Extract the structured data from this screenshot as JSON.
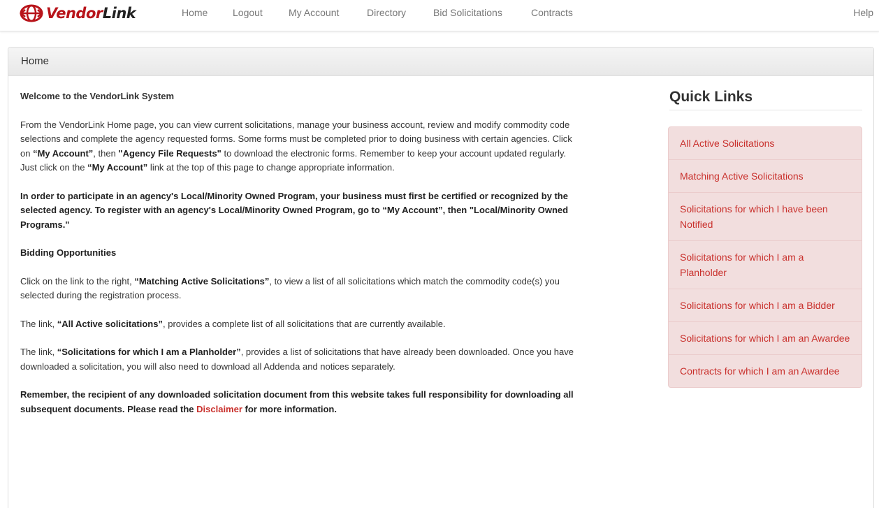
{
  "brand": {
    "name_part1": "Vendor",
    "name_part2": "Link"
  },
  "nav": {
    "items": [
      "Home",
      "Logout",
      "My Account",
      "Directory",
      "Bid Solicitations",
      "Contracts"
    ],
    "help": "Help"
  },
  "panel": {
    "heading": "Home"
  },
  "content": {
    "welcome_title": "Welcome to the VendorLink System",
    "intro": {
      "t1": "From the VendorLink Home page, you can view current solicitations, manage your business account, review and modify commodity code selections and complete the agency requested forms. Some forms must be completed prior to doing business with certain agencies. Click on ",
      "b1": "“My Account”",
      "t2": ", then ",
      "b2": "\"Agency File Requests\"",
      "t3": " to download the electronic forms. Remember to keep your account updated regularly. Just click on the ",
      "b3": "“My Account”",
      "t4": " link at the top of this page to change appropriate information."
    },
    "minority": "In order to participate in an agency's Local/Minority Owned Program, your business must first be certified or recognized by the selected agency. To register with an agency's Local/Minority Owned Program, go to “My Account”, then \"Local/Minority Owned Programs.\"",
    "bidding_title": "Bidding Opportunities",
    "matching": {
      "t1": "Click on the link to the right, ",
      "b1": "“Matching Active Solicitations”",
      "t2": ", to view a list of all solicitations which match the commodity code(s) you selected during the registration process."
    },
    "all_active": {
      "t1": "The link, ",
      "b1": "“All Active solicitations”",
      "t2": ", provides a complete list of all solicitations that are currently available."
    },
    "planholder": {
      "t1": "The link, ",
      "b1": "“Solicitations for which I am a Planholder”",
      "t2": ", provides a list of solicitations that have already been downloaded. Once you have downloaded a solicitation, you will also need to download all Addenda and notices separately."
    },
    "remember": {
      "t1": "Remember, the recipient of any downloaded solicitation document from this website takes full responsibility for downloading all subsequent documents. Please read the ",
      "link": "Disclaimer",
      "t2": " for more information."
    }
  },
  "quick_links": {
    "title": "Quick Links",
    "items": [
      "All Active Solicitations",
      "Matching Active Solicitations",
      "Solicitations for which I have been Notified",
      "Solicitations for which I am a Planholder",
      "Solicitations for which I am a Bidder",
      "Solicitations for which I am an Awardee",
      "Contracts for which I am an Awardee"
    ]
  },
  "colors": {
    "accent": "#c9302c",
    "brand": "#b8141a",
    "quick_link_bg": "#f2dede"
  }
}
